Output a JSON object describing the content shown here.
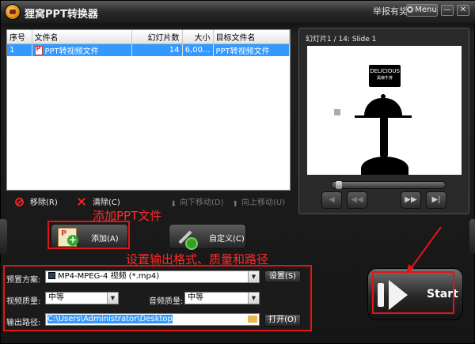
{
  "window": {
    "title": "狸窝PPT转换器",
    "report_label": "举报有奖",
    "menu_label": "Menu",
    "minimize_glyph": "—",
    "close_glyph": "✕"
  },
  "file_list": {
    "columns": [
      "序号",
      "文件名",
      "幻灯片数",
      "大小",
      "目标文件名"
    ],
    "rows": [
      {
        "index": "1",
        "filename": "PPT转视频文件",
        "slides": "14",
        "size": "6,00...",
        "target": "PPT转视频文件"
      }
    ]
  },
  "list_toolbar": {
    "remove_label": "移除(R)",
    "clear_label": "清除(C)",
    "move_down_label": "向下移动(D)",
    "move_up_label": "向上移动(U)",
    "move_down_glyph": "⬇",
    "move_up_glyph": "⬆"
  },
  "preview": {
    "caption": "幻灯片1 / 14: Slide 1",
    "logo_top": "DELICIOUS",
    "logo_bottom": "黑椒牛排",
    "buttons": {
      "prev_glyph": "◀",
      "rewind_glyph": "◀◀",
      "forward_glyph": "▶▶",
      "next_glyph": "▶|"
    },
    "seek_progress": 0.02
  },
  "actions": {
    "add_label": "添加(A)",
    "custom_label": "自定义(C)"
  },
  "annotations": {
    "add_file": "添加PPT文件",
    "output_settings": "设置输出格式、质量和路径"
  },
  "settings": {
    "preset_label": "预置方案:",
    "preset_value": "MP4-MPEG-4 视频 (*.mp4)",
    "settings_button": "设置(S)",
    "video_quality_label": "视频质量:",
    "video_quality_value": "中等",
    "audio_quality_label": "音频质量:",
    "audio_quality_value": "中等",
    "output_path_label": "输出路径:",
    "output_path_value": "C:\\Users\\Administrator\\Desktop",
    "open_button": "打开(O)",
    "dropdown_glyph": "▼"
  },
  "start": {
    "label": "Start"
  },
  "colors": {
    "annotation": "#e31414",
    "selection": "#3399ff"
  }
}
